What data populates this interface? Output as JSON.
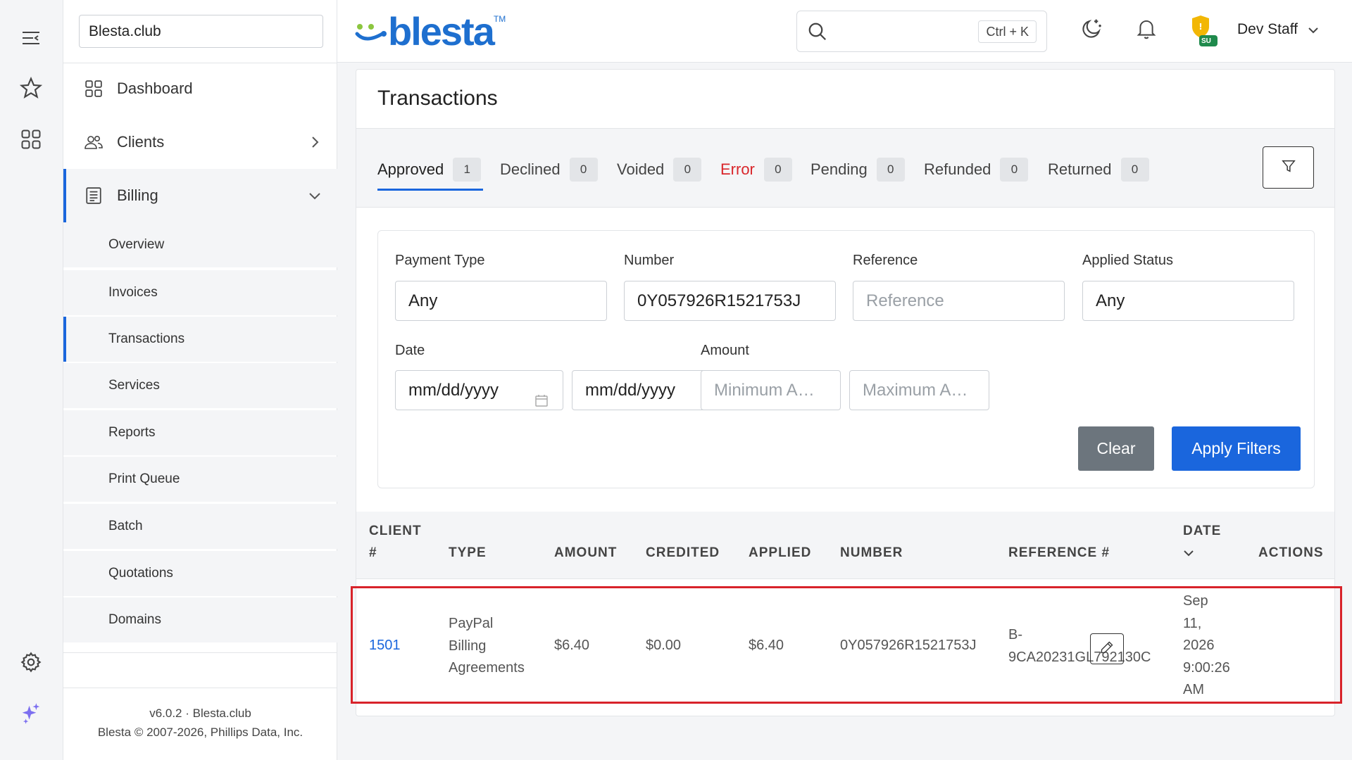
{
  "site_selector": {
    "value": "Blesta.club"
  },
  "logo": {
    "text": "blesta",
    "tm": "TM"
  },
  "search": {
    "shortcut": "Ctrl + K"
  },
  "header": {
    "user_name": "Dev Staff",
    "badge": "SU"
  },
  "nav": {
    "dashboard": "Dashboard",
    "clients": "Clients",
    "billing": "Billing",
    "billing_items": [
      "Overview",
      "Invoices",
      "Transactions",
      "Services",
      "Reports",
      "Print Queue",
      "Batch",
      "Quotations",
      "Domains"
    ]
  },
  "footer": {
    "version": "v6.0.2 · Blesta.club",
    "copyright": "Blesta © 2007-2026, Phillips Data, Inc."
  },
  "page": {
    "title": "Transactions"
  },
  "tabs": [
    {
      "label": "Approved",
      "count": "1"
    },
    {
      "label": "Declined",
      "count": "0"
    },
    {
      "label": "Voided",
      "count": "0"
    },
    {
      "label": "Error",
      "count": "0"
    },
    {
      "label": "Pending",
      "count": "0"
    },
    {
      "label": "Refunded",
      "count": "0"
    },
    {
      "label": "Returned",
      "count": "0"
    }
  ],
  "filters": {
    "payment_type_label": "Payment Type",
    "payment_type_value": "Any",
    "number_label": "Number",
    "number_value": "0Y057926R1521753J",
    "reference_label": "Reference",
    "reference_placeholder": "Reference",
    "applied_status_label": "Applied Status",
    "applied_status_value": "Any",
    "date_label": "Date",
    "date_from_placeholder": "mm/dd/yyyy",
    "date_to_placeholder": "mm/dd/yyyy",
    "amount_label": "Amount",
    "amount_min_placeholder": "Minimum A…",
    "amount_max_placeholder": "Maximum A…",
    "clear": "Clear",
    "apply": "Apply Filters"
  },
  "table": {
    "headers": {
      "client_1": "CLIENT",
      "client_2": "#",
      "type": "TYPE",
      "amount": "AMOUNT",
      "credited": "CREDITED",
      "applied": "APPLIED",
      "number": "NUMBER",
      "reference": "REFERENCE #",
      "date": "DATE",
      "actions": "ACTIONS"
    },
    "row": {
      "client": "1501",
      "type_1": "PayPal",
      "type_2": "Billing",
      "type_3": "Agreements",
      "amount": "$6.40",
      "credited": "$0.00",
      "applied": "$6.40",
      "number": "0Y057926R1521753J",
      "reference_1": "B-",
      "reference_2": "9CA20231GL792130C",
      "date_1": "Sep",
      "date_2": "11,",
      "date_3": "2026",
      "date_4": "9:00:26",
      "date_5": "AM"
    }
  }
}
